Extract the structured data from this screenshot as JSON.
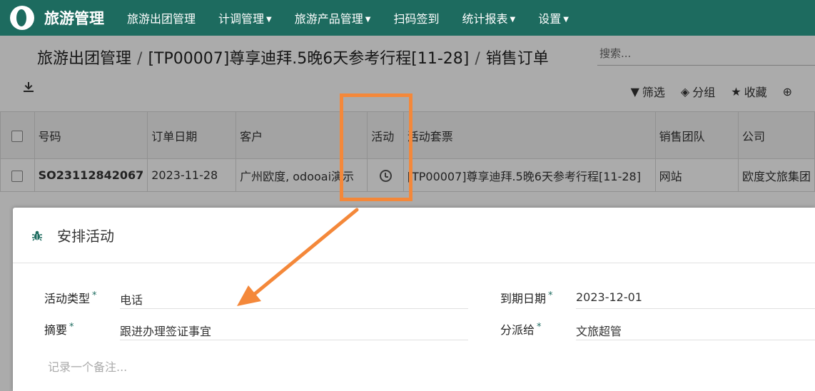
{
  "navbar": {
    "brand": "旅游管理",
    "items": [
      {
        "label": "旅游出团管理",
        "dropdown": false
      },
      {
        "label": "计调管理",
        "dropdown": true
      },
      {
        "label": "旅游产品管理",
        "dropdown": true
      },
      {
        "label": "扫码签到",
        "dropdown": false
      },
      {
        "label": "统计报表",
        "dropdown": true
      },
      {
        "label": "设置",
        "dropdown": true
      }
    ]
  },
  "breadcrumb": {
    "root": "旅游出团管理",
    "middle": "[TP00007]尊享迪拜.5晚6天参考行程[11-28]",
    "current": "销售订单"
  },
  "search": {
    "placeholder": "搜索..."
  },
  "toolbar": {
    "filter": "筛选",
    "group": "分组",
    "favorite": "收藏"
  },
  "table": {
    "headers": [
      "号码",
      "订单日期",
      "客户",
      "活动",
      "活动套票",
      "销售团队",
      "公司"
    ],
    "rows": [
      {
        "number": "SO23112842067",
        "date": "2023-11-28",
        "customer": "广州欧度, odooai演示",
        "activity_icon": "clock-icon",
        "ticket": "[TP00007]尊享迪拜.5晚6天参考行程[11-28]",
        "team": "网站",
        "company": "欧度文旅集团"
      }
    ]
  },
  "modal": {
    "title": "安排活动",
    "fields": {
      "activity_type_label": "活动类型",
      "activity_type_value": "电话",
      "summary_label": "摘要",
      "summary_value": "跟进办理签证事宜",
      "due_date_label": "到期日期",
      "due_date_value": "2023-12-01",
      "assigned_label": "分派给",
      "assigned_value": "文旅超管"
    },
    "note_placeholder": "记录一个备注..."
  },
  "colors": {
    "brand": "#1d6b5f",
    "annotation": "#f4883a"
  }
}
